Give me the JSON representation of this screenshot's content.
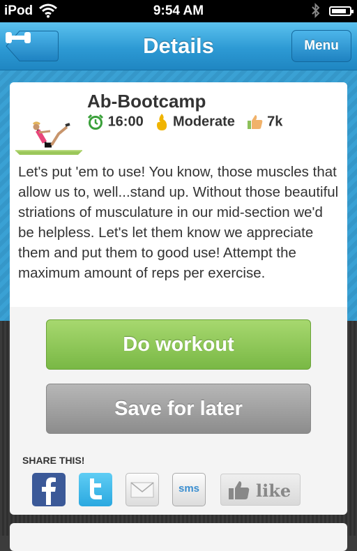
{
  "status_bar": {
    "carrier": "iPod",
    "time": "9:54 AM"
  },
  "nav": {
    "title": "Details",
    "menu_label": "Menu",
    "back_icon": "dumbbell-icon"
  },
  "workout": {
    "title": "Ab-Bootcamp",
    "duration": "16:00",
    "difficulty": "Moderate",
    "likes": "7k",
    "description": "Let's put 'em to use!  You know, those muscles that allow us to, well...stand up.  Without those beautiful striations of musculature in our mid-section we'd be helpless.  Let's let them know we appreciate them and put them to good use!  Attempt the maximum amount of reps per exercise."
  },
  "actions": {
    "do_workout": "Do workout",
    "save_later": "Save for later"
  },
  "share": {
    "label": "SHARE THIS!",
    "sms_label": "sms",
    "like_label": "like"
  },
  "colors": {
    "nav_blue": "#2d9ad4",
    "do_workout_green": "#79b845",
    "save_gray": "#8c8c8c",
    "facebook": "#3b5998",
    "twitter": "#2aa8e0"
  }
}
